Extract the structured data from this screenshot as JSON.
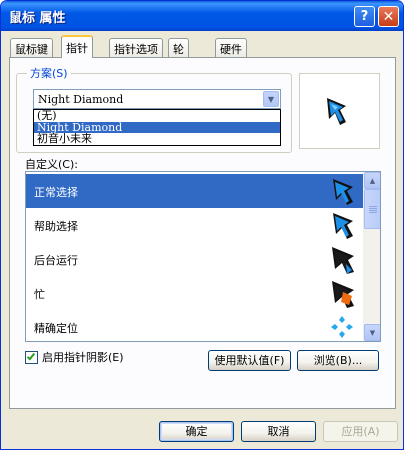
{
  "window": {
    "title": "鼠标 属性",
    "help_glyph": "?",
    "close_glyph": "✕"
  },
  "tabs": [
    {
      "label": "鼠标键",
      "active": false
    },
    {
      "label": "指针",
      "active": true
    },
    {
      "label": "指针选项",
      "active": false
    },
    {
      "label": "轮",
      "active": false
    },
    {
      "label": "硬件",
      "active": false
    }
  ],
  "scheme": {
    "label": "方案(S)",
    "selected": "Night Diamond",
    "options": [
      "(无)",
      "Night Diamond",
      "初音小未来"
    ],
    "highlighted_index": 1
  },
  "customize": {
    "label": "自定义(C):",
    "items": [
      {
        "label": "正常选择",
        "icon": "arrow-cursor-icon",
        "selected": true
      },
      {
        "label": "帮助选择",
        "icon": "help-cursor-icon",
        "selected": false
      },
      {
        "label": "后台运行",
        "icon": "working-cursor-icon",
        "selected": false
      },
      {
        "label": "忙",
        "icon": "busy-cursor-icon",
        "selected": false
      },
      {
        "label": "精确定位",
        "icon": "crosshair-cursor-icon",
        "selected": false
      }
    ]
  },
  "shadow": {
    "label": "启用指针阴影(E)",
    "checked": true
  },
  "buttons": {
    "use_default": "使用默认值(F)",
    "browse": "浏览(B)...",
    "ok": "确定",
    "cancel": "取消",
    "apply": "应用(A)"
  },
  "colors": {
    "selection": "#316ac5",
    "cursor_blue": "#1d8fe6",
    "cursor_orange": "#f06a10",
    "crosshair": "#2aa6ea"
  }
}
